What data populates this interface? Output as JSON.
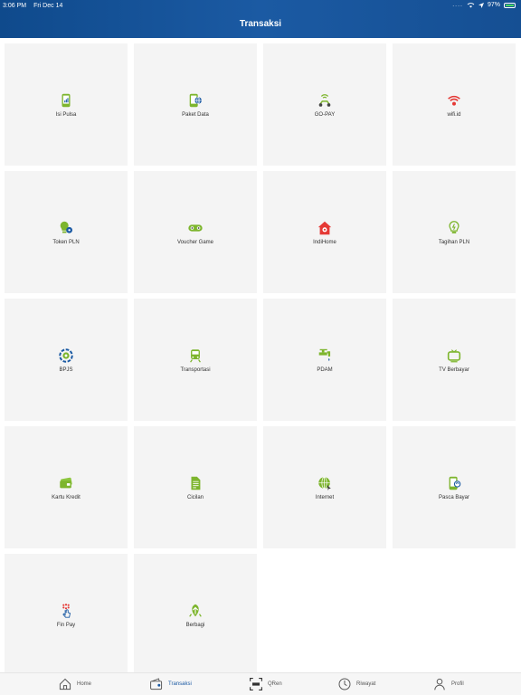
{
  "status": {
    "time": "3:06 PM",
    "date": "Fri Dec 14",
    "signal": "....",
    "battery": "97%"
  },
  "header": {
    "title": "Transaksi"
  },
  "tiles": [
    {
      "id": "isi-pulsa",
      "label": "Isi Pulsa",
      "icon": "phone-signal-icon"
    },
    {
      "id": "paket-data",
      "label": "Paket Data",
      "icon": "phone-globe-icon"
    },
    {
      "id": "go-pay",
      "label": "GO-PAY",
      "icon": "scooter-icon"
    },
    {
      "id": "wifi-id",
      "label": "wifi.id",
      "icon": "wifi-icon"
    },
    {
      "id": "token-pln",
      "label": "Token PLN",
      "icon": "bulb-token-icon"
    },
    {
      "id": "voucher-game",
      "label": "Voucher Game",
      "icon": "gamepad-icon"
    },
    {
      "id": "indihome",
      "label": "IndiHome",
      "icon": "house-icon"
    },
    {
      "id": "tagihan-pln",
      "label": "Tagihan PLN",
      "icon": "lightbulb-icon"
    },
    {
      "id": "bpjs",
      "label": "BPJS",
      "icon": "bpjs-logo-icon"
    },
    {
      "id": "transportasi",
      "label": "Transportasi",
      "icon": "train-icon"
    },
    {
      "id": "pdam",
      "label": "PDAM",
      "icon": "water-tap-icon"
    },
    {
      "id": "tv-berbayar",
      "label": "TV Berbayar",
      "icon": "tv-icon"
    },
    {
      "id": "kartu-kredit",
      "label": "Kartu Kredit",
      "icon": "credit-card-icon"
    },
    {
      "id": "cicilan",
      "label": "Cicilan",
      "icon": "document-icon"
    },
    {
      "id": "internet",
      "label": "Internet",
      "icon": "globe-icon"
    },
    {
      "id": "pasca-bayar",
      "label": "Pasca Bayar",
      "icon": "phone-refresh-icon"
    },
    {
      "id": "fin-pay",
      "label": "Fin Pay",
      "icon": "finpay-icon"
    },
    {
      "id": "berbagi",
      "label": "Berbagi",
      "icon": "share-icon"
    }
  ],
  "nav": [
    {
      "id": "home",
      "label": "Home",
      "icon": "home-icon"
    },
    {
      "id": "transaksi",
      "label": "Transaksi",
      "icon": "wallet-icon",
      "active": true
    },
    {
      "id": "qren",
      "label": "QRen",
      "icon": "qr-scan-icon"
    },
    {
      "id": "riwayat",
      "label": "Riwayat",
      "icon": "clock-icon"
    },
    {
      "id": "profil",
      "label": "Profil",
      "icon": "user-icon"
    }
  ],
  "colors": {
    "header": "#1b5aa3",
    "accent_green": "#7db52d",
    "accent_red": "#e53935",
    "accent_blue": "#1b5aa3",
    "tile_bg": "#f4f4f4"
  }
}
